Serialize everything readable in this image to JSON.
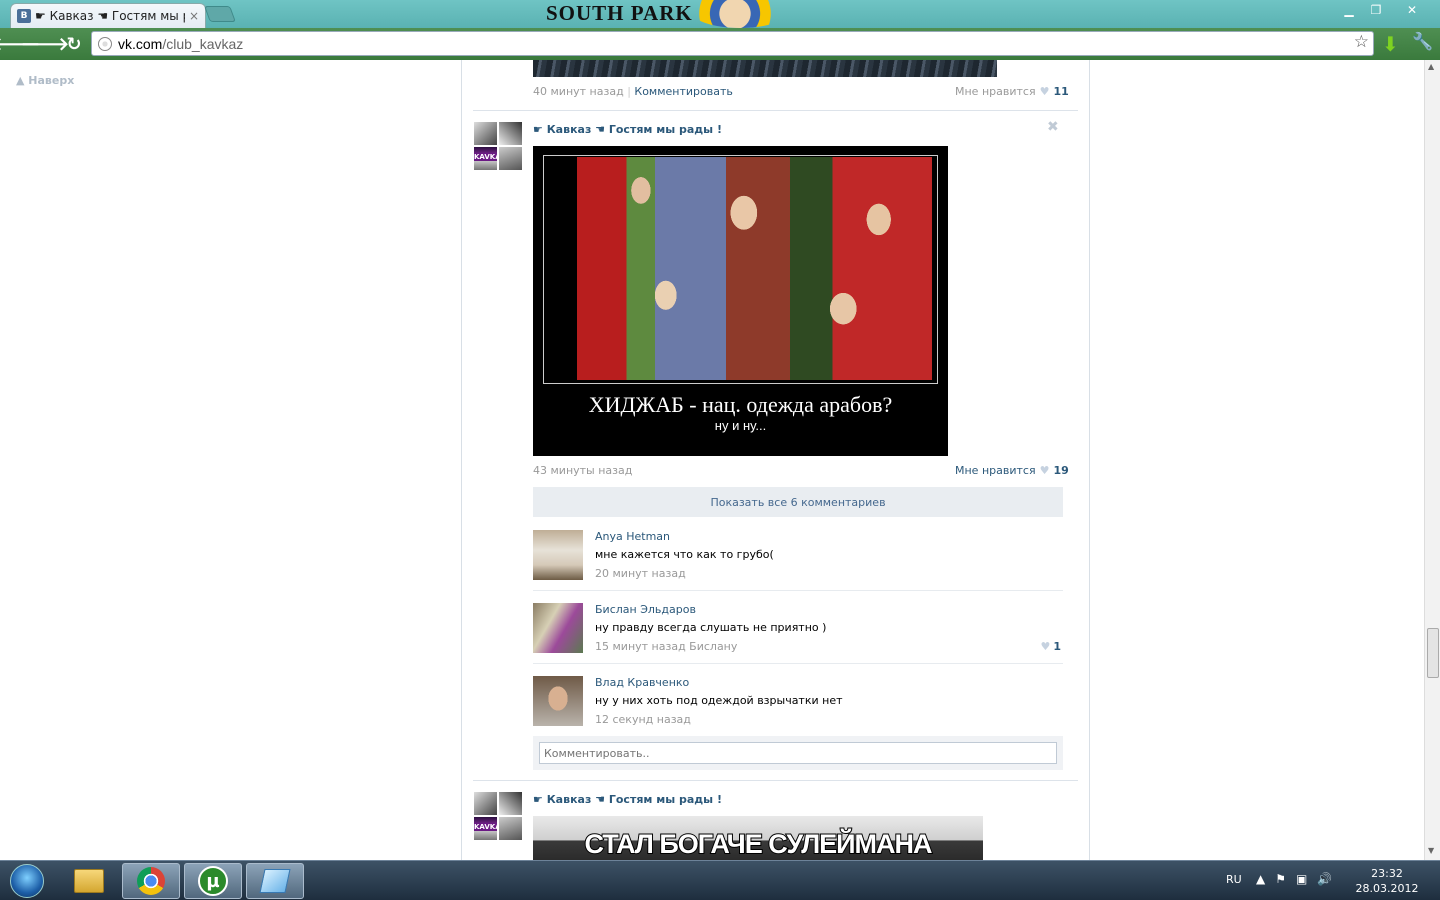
{
  "browser": {
    "tab_title": "☛ Кавказ ☚ Гостям мы рад",
    "tab_favicon": "В",
    "banner_text": "SOUTH PARK",
    "url_host": "vk.com",
    "url_path": "/club_kavkaz",
    "back_icon": "🡐",
    "forward_icon": "🡒",
    "reload_icon": "↻",
    "star_icon": "☆",
    "download_icon": "⬇",
    "wrench_icon": "🔧",
    "min_icon": "▁",
    "max_icon": "❐",
    "close_icon": "✕",
    "tab_close_icon": "×"
  },
  "page": {
    "to_top": "Наверх",
    "prev_post": {
      "time": "40 минут назад",
      "comment_link": "Комментировать",
      "like_label": "Мне нравится",
      "like_count": "11"
    },
    "post": {
      "author": "☛ Кавказ ☚ Гостям мы рады !",
      "avatar_label": "KAVKAZ",
      "close_icon": "✖",
      "image_title": "ХИДЖАБ - нац. одежда арабов?",
      "image_subtitle": "ну и ну...",
      "time": "43 минуты назад",
      "like_label": "Мне нравится",
      "like_count": "19",
      "show_all_comments": "Показать все 6 комментариев",
      "comments": [
        {
          "author": "Anya Hetman",
          "text": "мне кажется что как то грубо(",
          "time": "20 минут назад",
          "likes": ""
        },
        {
          "author": "Бислан Эльдаров",
          "text": "ну правду всегда слушать не приятно )",
          "time": "15 минут назад Бислану",
          "likes": "1"
        },
        {
          "author": "Влад Кравченко",
          "text": "ну у них хоть под одеждой взрычатки нет",
          "time": "12 секунд назад",
          "likes": ""
        }
      ],
      "reply_placeholder": "Комментировать.."
    },
    "next_post": {
      "author": "☛ Кавказ ☚ Гостям мы рады !",
      "avatar_label": "KAVKAZ",
      "image_text": "СТАЛ БОГАЧЕ СУЛЕЙМАНА КЕРИМОВА"
    }
  },
  "taskbar": {
    "lang": "RU",
    "time": "23:32",
    "date": "28.03.2012",
    "utorrent_glyph": "µ"
  }
}
